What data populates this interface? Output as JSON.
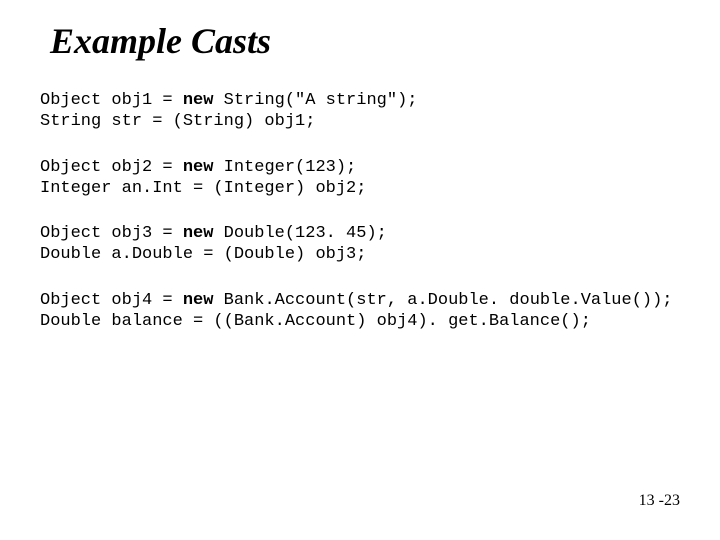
{
  "title": "Example Casts",
  "code1": {
    "kw": "new",
    "pre1": "Object obj1 = ",
    "post1": " String(\"A string\");",
    "line2": "String str = (String) obj1;"
  },
  "code2": {
    "kw": "new",
    "pre1": "Object obj2 = ",
    "post1": " Integer(123);",
    "line2": "Integer an.Int = (Integer) obj2;"
  },
  "code3": {
    "kw": "new",
    "pre1": "Object obj3 = ",
    "post1": " Double(123. 45);",
    "line2": "Double a.Double = (Double) obj3;"
  },
  "code4": {
    "kw": "new",
    "pre1": "Object obj4 = ",
    "post1": " Bank.Account(str, a.Double. double.Value());",
    "line2": "Double balance = ((Bank.Account) obj4). get.Balance();"
  },
  "page": "13 -23"
}
